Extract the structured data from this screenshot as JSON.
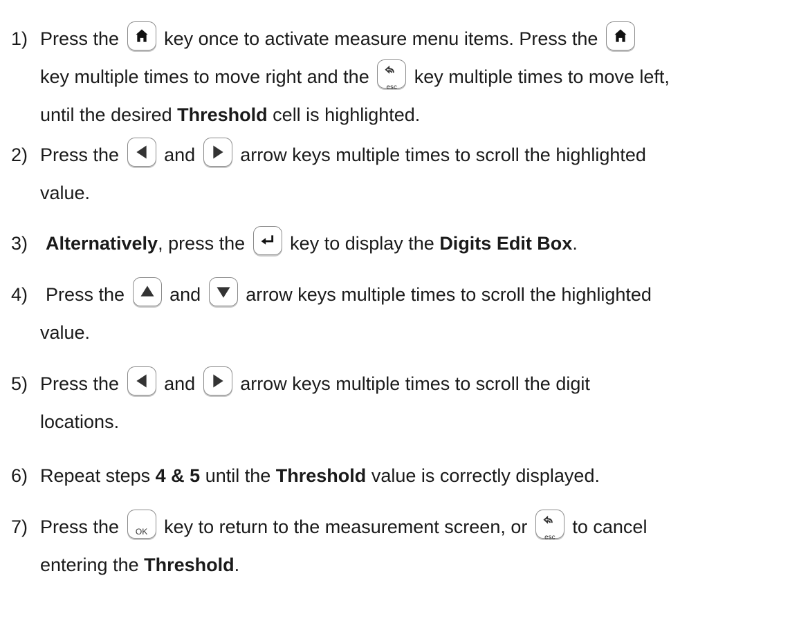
{
  "steps": [
    {
      "num": "1)",
      "l1a": "Press the",
      "l1b": "key once to activate measure menu items.  Press the",
      "l2a": "key multiple times to move right and the",
      "l2b": "key multiple times to move left,",
      "l3a": "until the desired",
      "l3b": "Threshold",
      "l3c": "cell is highlighted."
    },
    {
      "num": "2)",
      "l1a": "Press the",
      "l1b": "and",
      "l1c": "arrow keys multiple times to scroll the highlighted",
      "l2a": "value."
    },
    {
      "num": "3)",
      "l1a": "Alternatively",
      "l1b": ", press the",
      "l1c": "key to display the",
      "l1d": "Digits Edit Box",
      "l1e": "."
    },
    {
      "num": "4)",
      "l1a": "Press the",
      "l1b": "and",
      "l1c": "arrow keys multiple times to scroll the highlighted",
      "l2a": "value."
    },
    {
      "num": "5)",
      "l1a": "Press the",
      "l1b": "and",
      "l1c": "arrow keys multiple times to scroll the digit",
      "l2a": "locations."
    },
    {
      "num": "6)",
      "l1a": "Repeat steps",
      "l1b": "4 & 5",
      "l1c": "until the",
      "l1d": "Threshold",
      "l1e": "value is correctly displayed."
    },
    {
      "num": "7)",
      "l1a": "Press the",
      "l1b": "key to return to the measurement screen, or",
      "l1c": "to cancel",
      "l2a": "entering the",
      "l2b": "Threshold",
      "l2c": "."
    }
  ],
  "keys": {
    "esc": "esc",
    "ok": "OK"
  },
  "icons": {
    "home": "home-key-icon",
    "esc": "esc-back-key-icon",
    "left": "left-arrow-key-icon",
    "right": "right-arrow-key-icon",
    "up": "up-arrow-key-icon",
    "down": "down-arrow-key-icon",
    "enter": "enter-key-icon",
    "ok": "ok-key-icon"
  }
}
